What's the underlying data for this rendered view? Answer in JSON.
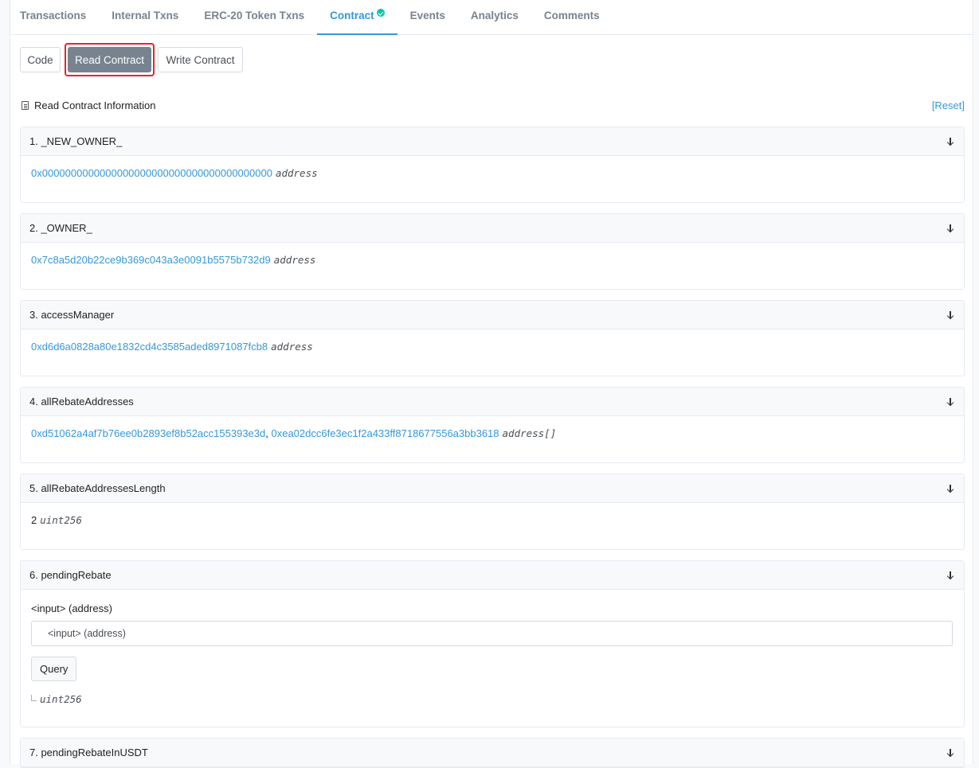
{
  "tabs": [
    {
      "label": "Transactions"
    },
    {
      "label": "Internal Txns"
    },
    {
      "label": "ERC-20 Token Txns"
    },
    {
      "label": "Contract"
    },
    {
      "label": "Events"
    },
    {
      "label": "Analytics"
    },
    {
      "label": "Comments"
    }
  ],
  "subnav": {
    "code": "Code",
    "read": "Read Contract",
    "write": "Write Contract"
  },
  "info": {
    "title": "Read Contract Information",
    "reset": "[Reset]"
  },
  "items": [
    {
      "header": "1. _NEW_OWNER_",
      "value": "0x0000000000000000000000000000000000000000",
      "type": "address"
    },
    {
      "header": "2. _OWNER_",
      "value": "0x7c8a5d20b22ce9b369c043a3e0091b5575b732d9",
      "type": "address"
    },
    {
      "header": "3. accessManager",
      "value": "0xd6d6a0828a80e1832cd4c3585aded8971087fcb8",
      "type": "address"
    },
    {
      "header": "4. allRebateAddresses",
      "value": "0xd51062a4af7b76ee0b2893ef8b52acc155393e3d",
      "value2": "0xea02dcc6fe3ec1f2a433ff8718677556a3bb3618",
      "sep": ",",
      "type": "address[]"
    },
    {
      "header": "5. allRebateAddressesLength",
      "value": "2",
      "type": "uint256"
    },
    {
      "header": "6. pendingRebate",
      "input_label": "<input> (address)",
      "input_placeholder": "<input> (address)",
      "query": "Query",
      "type": "uint256"
    },
    {
      "header": "7. pendingRebateInUSDT"
    }
  ]
}
